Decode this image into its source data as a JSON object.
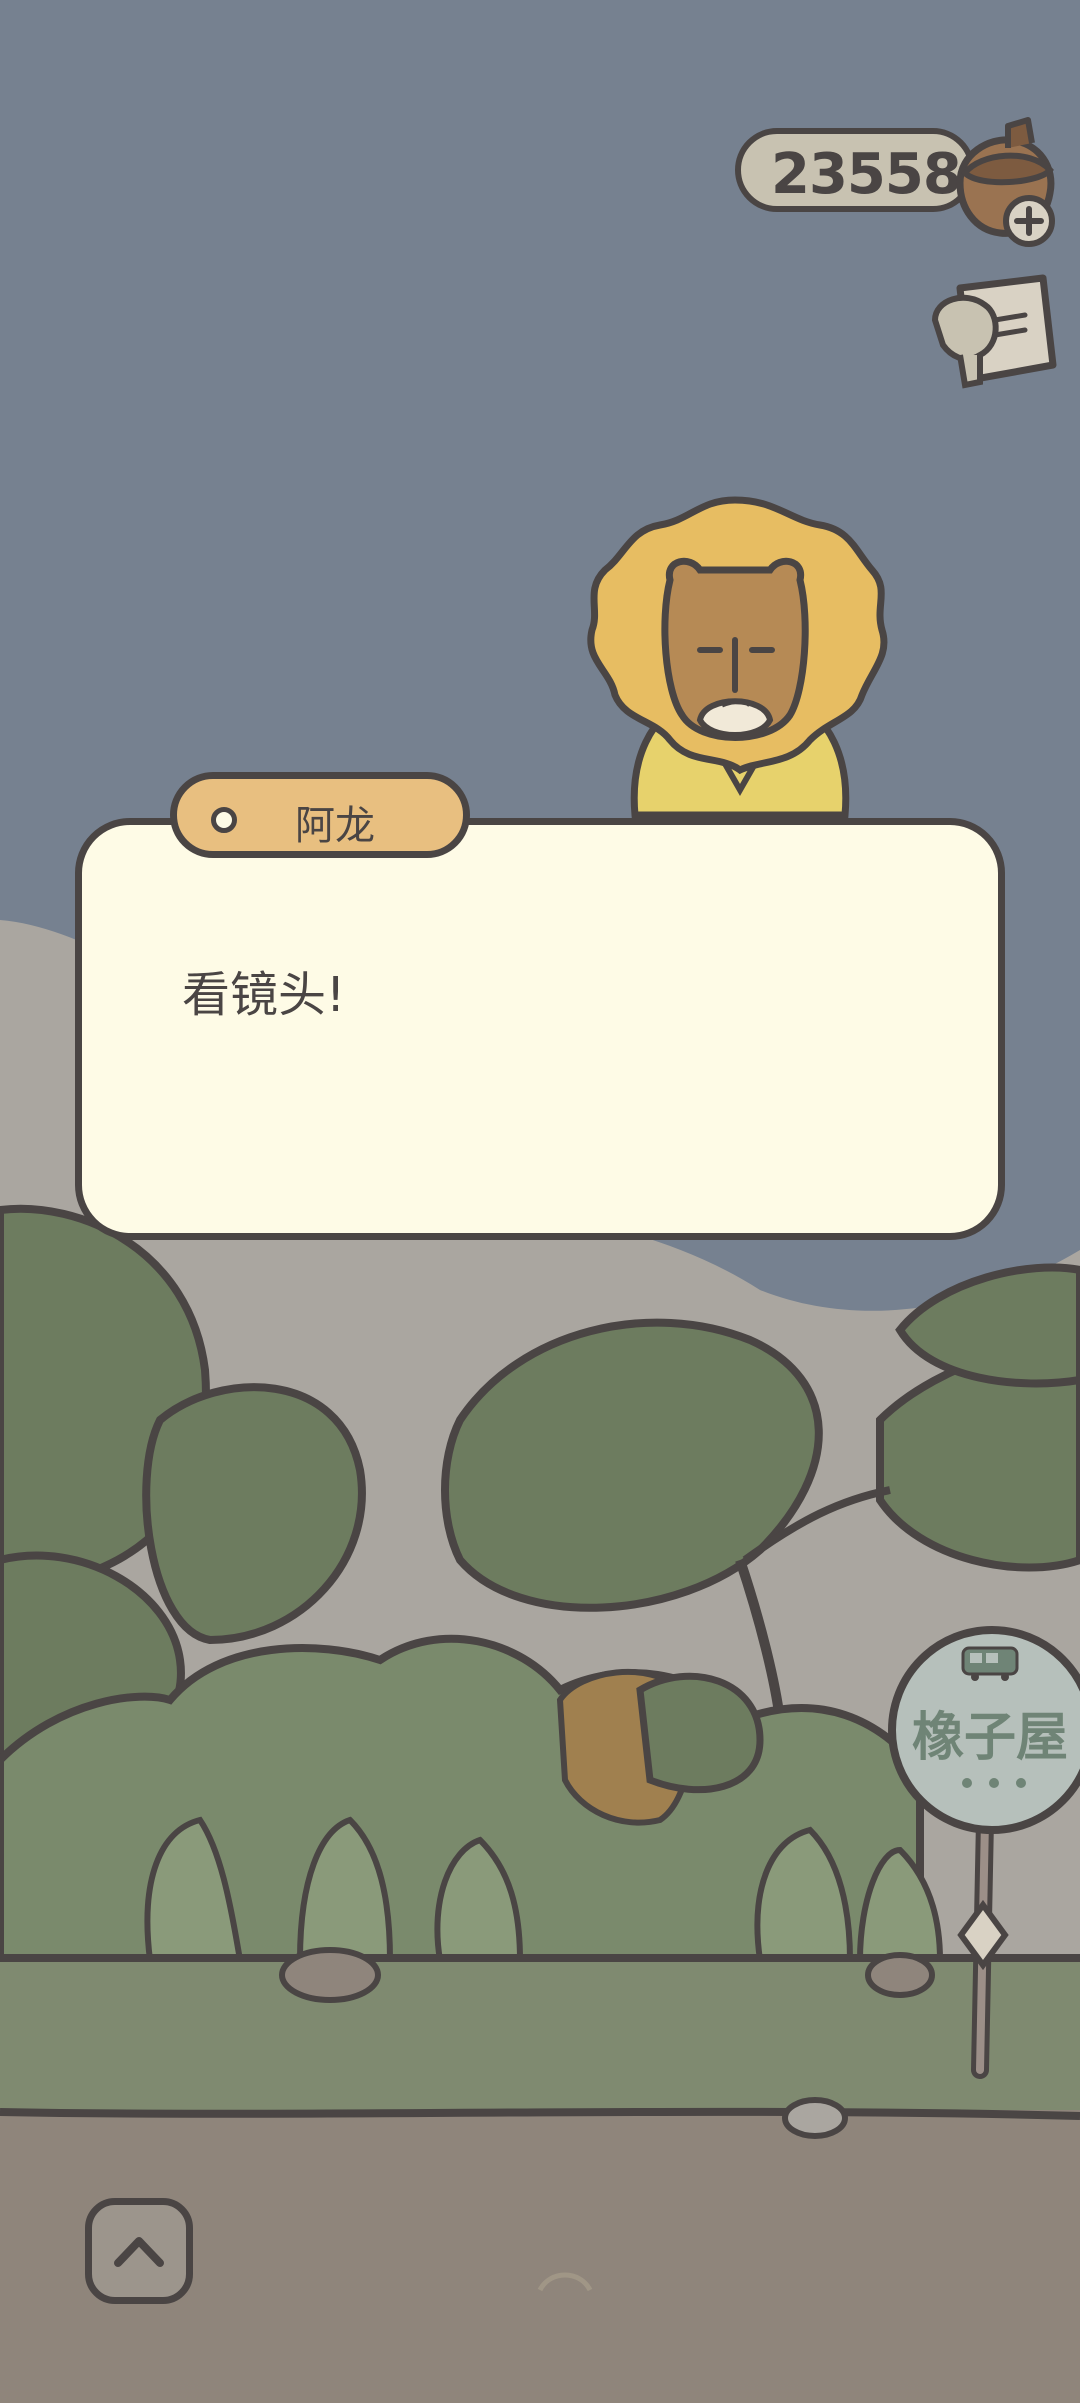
{
  "hud": {
    "acorn_count": "23558",
    "acorn_icon": "acorn-icon",
    "add_icon": "plus-icon",
    "album_icon": "photo-album-icon"
  },
  "dialog": {
    "speaker": "阿龙",
    "text": "看镜头!"
  },
  "bus_stop": {
    "sign_text": "橡子屋",
    "icon": "bus-icon"
  },
  "controls": {
    "expand_icon": "chevron-up-icon"
  },
  "colors": {
    "sky": "#768190",
    "dialog_bg": "#fefbe6",
    "name_tag": "#e8bf80",
    "outline": "#4a4544",
    "foliage": "#6d7c5f"
  }
}
